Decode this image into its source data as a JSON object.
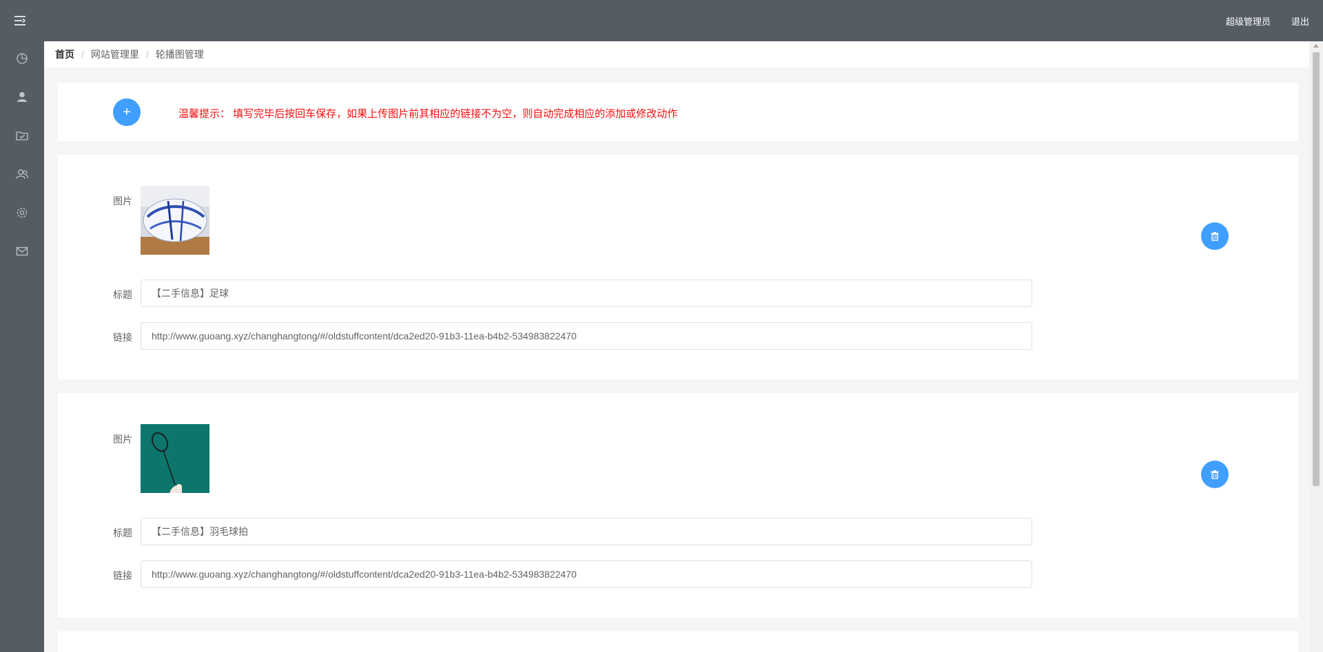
{
  "header": {
    "user_label": "超级管理员",
    "logout_label": "退出"
  },
  "sidebar": {
    "icons": [
      "menu-toggle-icon",
      "pie-chart-icon",
      "user-icon",
      "folder-checked-icon",
      "user-group-icon",
      "settings-icon",
      "message-icon"
    ]
  },
  "breadcrumb": {
    "items": [
      "首页",
      "网站管理里",
      "轮播图管理"
    ]
  },
  "tip": {
    "add_symbol": "+",
    "text": "温馨提示： 填写完毕后按回车保存，如果上传图片前其相应的链接不为空，则自动完成相应的添加或修改动作"
  },
  "labels": {
    "image": "图片",
    "title": "标题",
    "link": "链接"
  },
  "items": [
    {
      "image_icon": "soccer-ball-photo",
      "title": "【二手信息】足球",
      "link": "http://www.guoang.xyz/changhangtong/#/oldstuffcontent/dca2ed20-91b3-11ea-b4b2-534983822470"
    },
    {
      "image_icon": "badminton-racket-photo",
      "title": "【二手信息】羽毛球拍",
      "link": "http://www.guoang.xyz/changhangtong/#/oldstuffcontent/dca2ed20-91b3-11ea-b4b2-534983822470"
    }
  ],
  "colors": {
    "topbar": "#545c64",
    "accent": "#409eff",
    "tip": "#f40f0f"
  }
}
